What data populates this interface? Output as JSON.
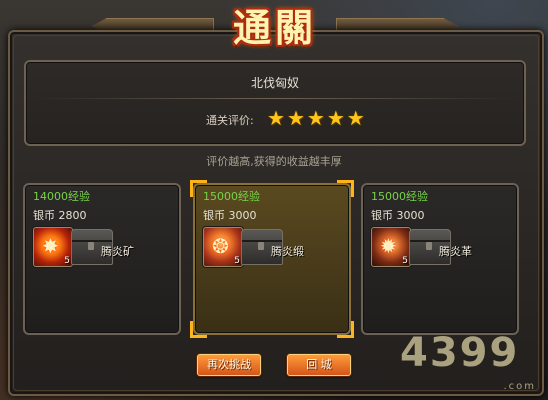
{
  "title": "通關",
  "level": {
    "name": "北伐匈奴",
    "rating_label": "通关评价:",
    "stars": 5,
    "star_glyph": "★"
  },
  "hint": "评价越高,获得的收益越丰厚",
  "cards": [
    {
      "exp": "14000经验",
      "silver": "银币  2800",
      "item_name": "腾炎矿",
      "item_count": "5",
      "item_icon": "fire-ore-icon",
      "selected": false
    },
    {
      "exp": "15000经验",
      "silver": "银币  3000",
      "item_name": "腾炎缎",
      "item_count": "5",
      "item_icon": "fire-silk-icon",
      "selected": true
    },
    {
      "exp": "15000经验",
      "silver": "银币  3000",
      "item_name": "腾炎革",
      "item_count": "5",
      "item_icon": "fire-leather-icon",
      "selected": false
    }
  ],
  "buttons": {
    "retry": "再次挑战",
    "return": "回  城"
  },
  "watermark": {
    "text": "4399",
    "domain": ".com"
  },
  "colors": {
    "exp_green": "#78d24a",
    "star_gold": "#ffc61a",
    "button_orange": "#d4561a",
    "selected_corner": "#ffb21a"
  }
}
